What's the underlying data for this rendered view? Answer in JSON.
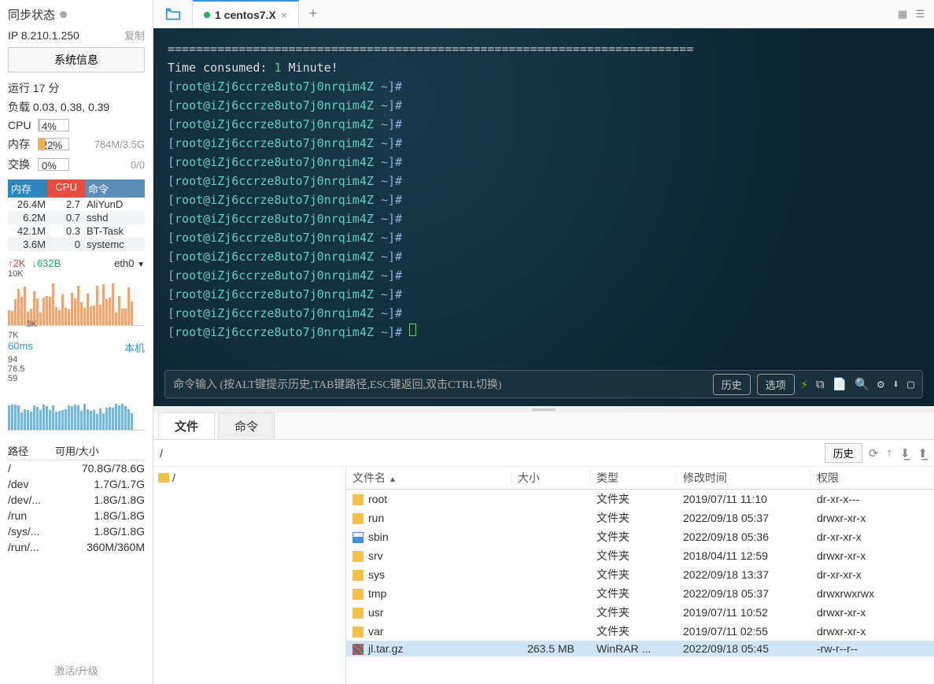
{
  "sidebar": {
    "sync_label": "同步状态",
    "ip_label": "IP 8.210.1.250",
    "copy_label": "复制",
    "sysinfo_btn": "系统信息",
    "uptime": "运行 17 分",
    "load": "负载 0.03, 0.38, 0.39",
    "cpu": {
      "label": "CPU",
      "pct": "4%",
      "fill": 4
    },
    "mem": {
      "label": "内存",
      "pct": "22%",
      "fill": 22,
      "extra": "784M/3.5G"
    },
    "swap": {
      "label": "交换",
      "pct": "0%",
      "fill": 0,
      "extra": "0/0"
    },
    "proc_header": {
      "mem": "内存",
      "cpu": "CPU",
      "cmd": "命令"
    },
    "processes": [
      {
        "mem": "26.4M",
        "cpu": "2.7",
        "cmd": "AliYunD"
      },
      {
        "mem": "6.2M",
        "cpu": "0.7",
        "cmd": "sshd"
      },
      {
        "mem": "42.1M",
        "cpu": "0.3",
        "cmd": "BT-Task"
      },
      {
        "mem": "3.6M",
        "cpu": "0",
        "cmd": "systemc"
      }
    ],
    "net": {
      "up": "↑2K",
      "down": "↓632B",
      "iface": "eth0"
    },
    "chart1_y": [
      "10K",
      "7K",
      "3K"
    ],
    "latency": {
      "val": "60ms",
      "local": "本机"
    },
    "chart2_y": [
      "94",
      "76.5",
      "59"
    ],
    "disk_header": {
      "path": "路径",
      "size": "可用/大小"
    },
    "disks": [
      {
        "path": "/",
        "size": "70.8G/78.6G"
      },
      {
        "path": "/dev",
        "size": "1.7G/1.7G"
      },
      {
        "path": "/dev/...",
        "size": "1.8G/1.8G"
      },
      {
        "path": "/run",
        "size": "1.8G/1.8G"
      },
      {
        "path": "/sys/...",
        "size": "1.8G/1.8G"
      },
      {
        "path": "/run/...",
        "size": "360M/360M"
      }
    ],
    "activate": "激活/升级"
  },
  "tabs": {
    "title": "1 centos7.X"
  },
  "terminal": {
    "separator": "==========================================================================",
    "time_line_pre": "Time consumed: ",
    "time_line_val": "1",
    "time_line_post": " Minute!",
    "prompt": "[root@iZj6ccrze8uto7j0nrqim4Z ~]#",
    "prompt_count": 14,
    "cmd_placeholder": "命令输入 (按ALT键提示历史,TAB键路径,ESC键返回,双击CTRL切换)",
    "history_btn": "历史",
    "options_btn": "选项"
  },
  "bottom": {
    "tab_files": "文件",
    "tab_cmd": "命令",
    "path": "/",
    "history_btn": "历史",
    "tree_root": "/",
    "columns": {
      "name": "文件名",
      "size": "大小",
      "type": "类型",
      "time": "修改时间",
      "perm": "权限"
    },
    "files": [
      {
        "icon": "folder",
        "name": "root",
        "size": "",
        "type": "文件夹",
        "time": "2019/07/11 11:10",
        "perm": "dr-xr-x---"
      },
      {
        "icon": "folder",
        "name": "run",
        "size": "",
        "type": "文件夹",
        "time": "2022/09/18 05:37",
        "perm": "drwxr-xr-x"
      },
      {
        "icon": "sbin",
        "name": "sbin",
        "size": "",
        "type": "文件夹",
        "time": "2022/09/18 05:36",
        "perm": "dr-xr-xr-x"
      },
      {
        "icon": "folder",
        "name": "srv",
        "size": "",
        "type": "文件夹",
        "time": "2018/04/11 12:59",
        "perm": "drwxr-xr-x"
      },
      {
        "icon": "folder",
        "name": "sys",
        "size": "",
        "type": "文件夹",
        "time": "2022/09/18 13:37",
        "perm": "dr-xr-xr-x"
      },
      {
        "icon": "folder",
        "name": "tmp",
        "size": "",
        "type": "文件夹",
        "time": "2022/09/18 05:37",
        "perm": "drwxrwxrwx"
      },
      {
        "icon": "folder",
        "name": "usr",
        "size": "",
        "type": "文件夹",
        "time": "2019/07/11 10:52",
        "perm": "drwxr-xr-x"
      },
      {
        "icon": "folder",
        "name": "var",
        "size": "",
        "type": "文件夹",
        "time": "2019/07/11 02:55",
        "perm": "drwxr-xr-x"
      },
      {
        "icon": "rar",
        "name": "jl.tar.gz",
        "size": "263.5 MB",
        "type": "WinRAR ...",
        "time": "2022/09/18 05:45",
        "perm": "-rw-r--r--",
        "selected": true
      }
    ]
  }
}
